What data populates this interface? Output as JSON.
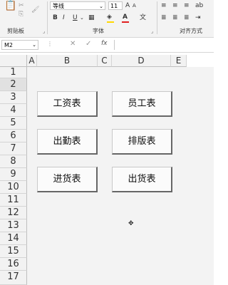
{
  "ribbon": {
    "clipboard_label": "剪贴板",
    "font_group_label": "字体",
    "alignment_label": "对齐方式",
    "font_name": "等线",
    "font_size": "11",
    "bold": "B",
    "italic": "I",
    "underline": "U"
  },
  "formula_bar": {
    "name_box": "M2",
    "fx": "fx"
  },
  "columns": [
    "A",
    "B",
    "C",
    "D",
    "E"
  ],
  "rows": [
    "1",
    "2",
    "3",
    "4",
    "5",
    "6",
    "7",
    "8",
    "9",
    "10",
    "11",
    "12",
    "13",
    "14",
    "15",
    "16",
    "17"
  ],
  "buttons": {
    "gongzi": "工资表",
    "yuangong": "员工表",
    "chuqin": "出勤表",
    "paiban": "排版表",
    "jinhuo": "进货表",
    "chuhuo": "出货表"
  },
  "colors": {
    "ribbon_bg": "#f3f3f3",
    "sheet_bg": "#f3f3f3",
    "font_color_bar": "#e02020",
    "fill_bar": "#ffd800"
  }
}
